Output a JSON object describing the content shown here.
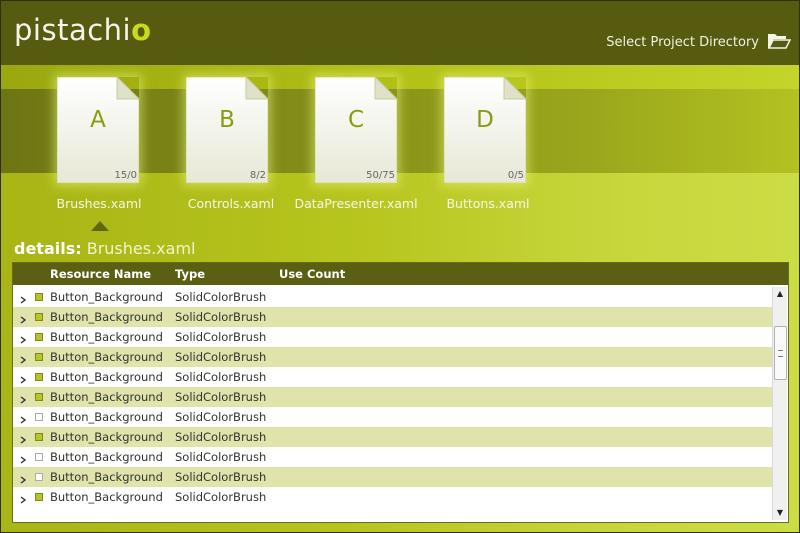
{
  "app": {
    "logo_text": "pistachi",
    "logo_accent": "o",
    "select_dir_label": "Select Project Directory"
  },
  "files": [
    {
      "letter": "A",
      "count": "15/0",
      "name": "Brushes.xaml",
      "selected": true
    },
    {
      "letter": "B",
      "count": "8/2",
      "name": "Controls.xaml",
      "selected": false
    },
    {
      "letter": "C",
      "count": "50/75",
      "name": "DataPresenter.xaml",
      "selected": false
    },
    {
      "letter": "D",
      "count": "0/5",
      "name": "Buttons.xaml",
      "selected": false
    }
  ],
  "details": {
    "prefix": "details:",
    "filename": "Brushes.xaml"
  },
  "table": {
    "columns": [
      "Resource Name",
      "Type",
      "Use Count"
    ],
    "rows": [
      {
        "name": "Button_Background",
        "type": "SolidColorBrush",
        "used": true
      },
      {
        "name": "Button_Background",
        "type": "SolidColorBrush",
        "used": true
      },
      {
        "name": "Button_Background",
        "type": "SolidColorBrush",
        "used": true
      },
      {
        "name": "Button_Background",
        "type": "SolidColorBrush",
        "used": true
      },
      {
        "name": "Button_Background",
        "type": "SolidColorBrush",
        "used": true
      },
      {
        "name": "Button_Background",
        "type": "SolidColorBrush",
        "used": true
      },
      {
        "name": "Button_Background",
        "type": "SolidColorBrush",
        "used": false
      },
      {
        "name": "Button_Background",
        "type": "SolidColorBrush",
        "used": true
      },
      {
        "name": "Button_Background",
        "type": "SolidColorBrush",
        "used": false
      },
      {
        "name": "Button_Background",
        "type": "SolidColorBrush",
        "used": false
      },
      {
        "name": "Button_Background",
        "type": "SolidColorBrush",
        "used": true
      }
    ]
  },
  "colors": {
    "header": "#565b10",
    "accent": "#c8da1a",
    "row_alt": "#e0e3aa"
  },
  "icons": {
    "select_dir": "folder-open-icon",
    "expand": "expand-arrow-icon",
    "swatch": "color-swatch-icon",
    "scroll_up": "scroll-up-arrow-icon",
    "scroll_down": "scroll-down-arrow-icon"
  }
}
